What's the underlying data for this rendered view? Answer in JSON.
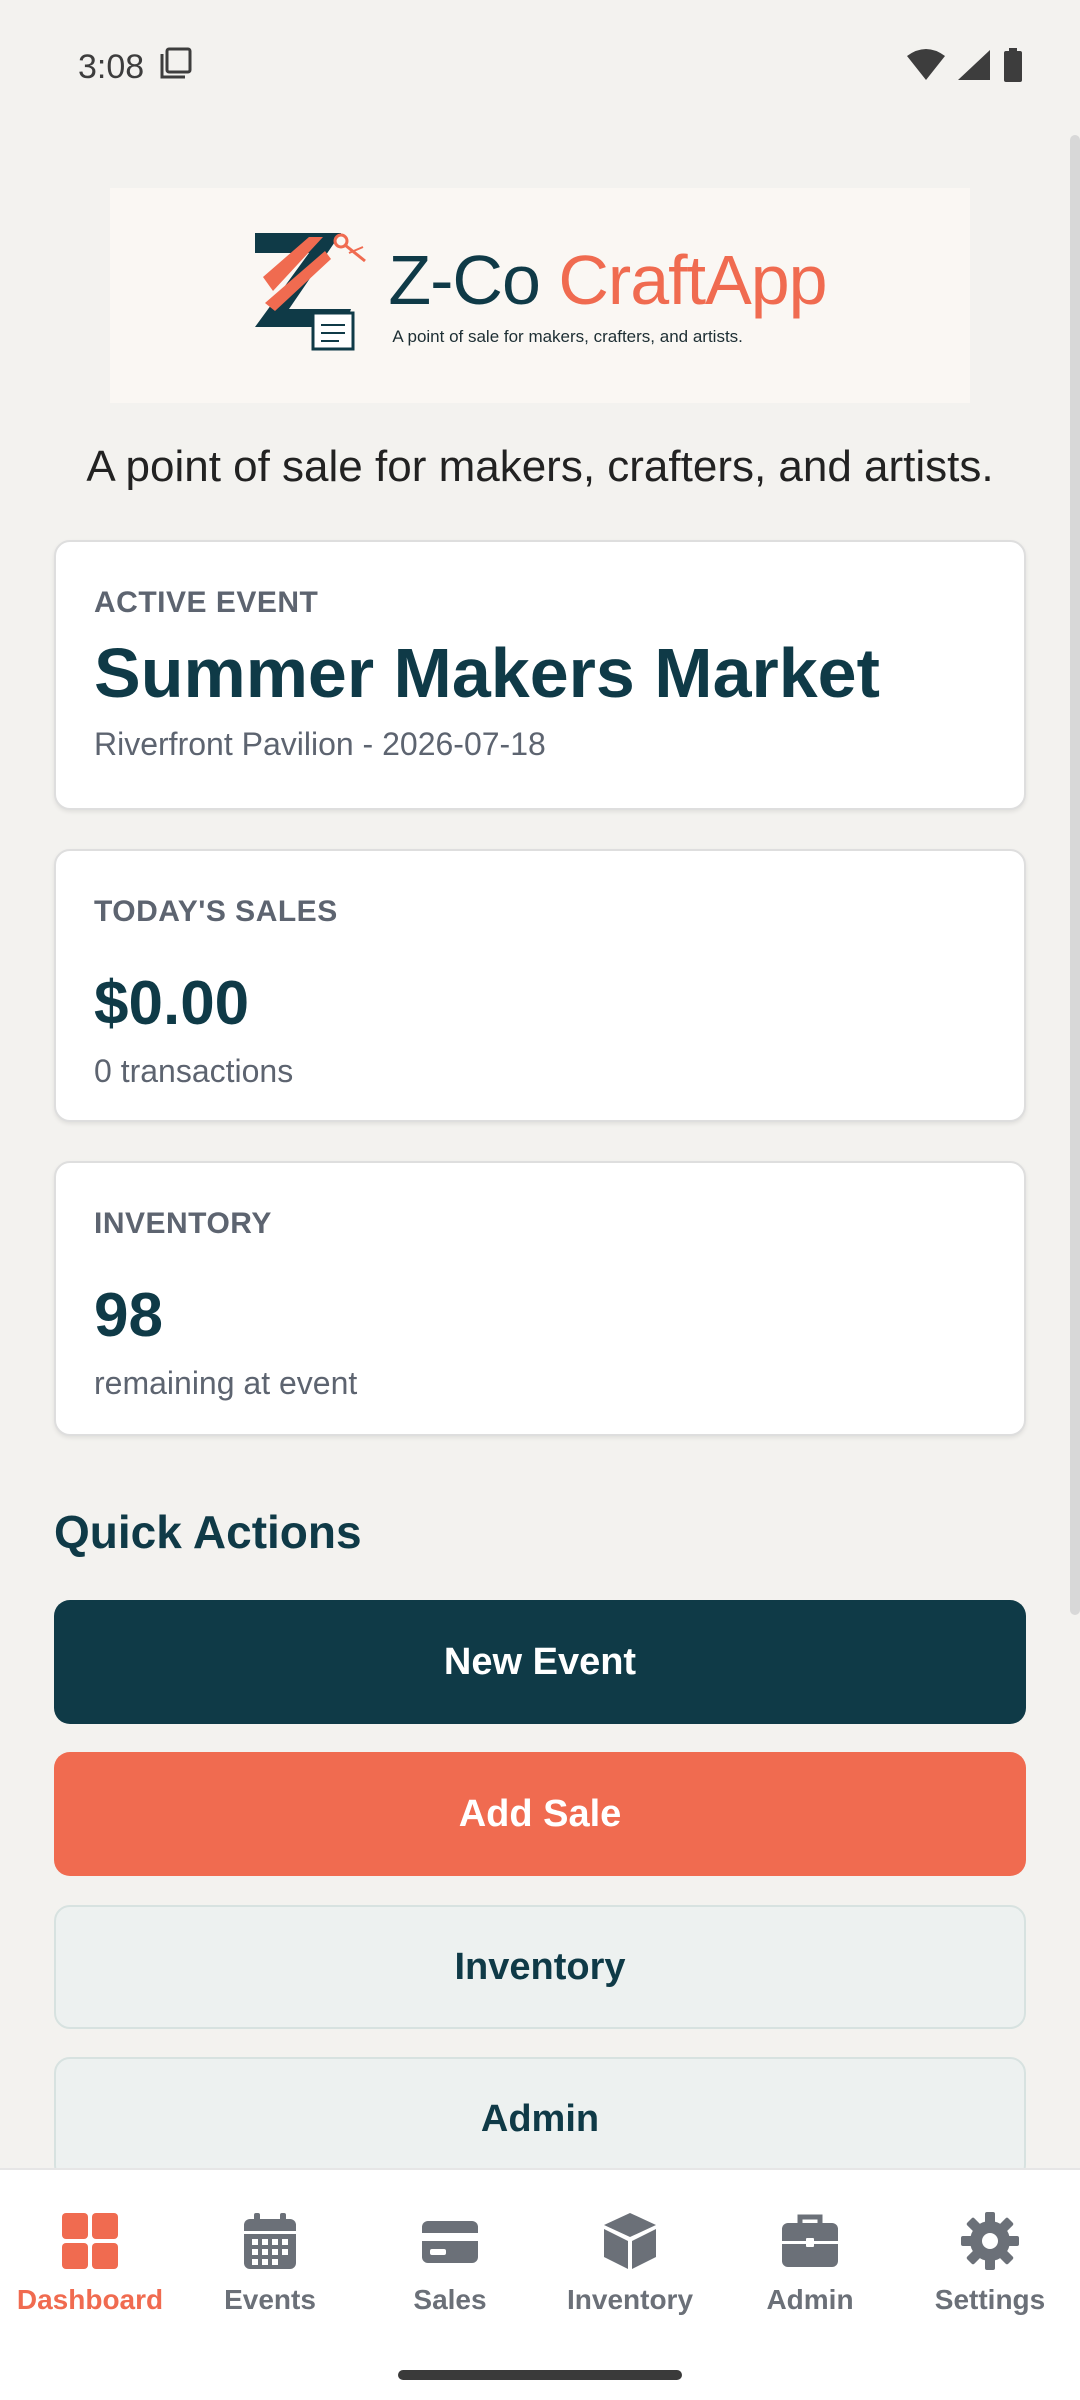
{
  "status_bar": {
    "time": "3:08"
  },
  "logo": {
    "title_part1": "Z-Co",
    "title_part2": "CraftApp",
    "subtitle": "A point of sale for makers, crafters, and artists."
  },
  "tagline": "A point of sale for makers, crafters, and artists.",
  "cards": {
    "active_event": {
      "label": "ACTIVE EVENT",
      "title": "Summer Makers Market",
      "sub": "Riverfront Pavilion - 2026-07-18"
    },
    "todays_sales": {
      "label": "TODAY'S SALES",
      "value": "$0.00",
      "sub": "0 transactions"
    },
    "inventory": {
      "label": "INVENTORY",
      "value": "98",
      "sub": "remaining at event"
    }
  },
  "quick_actions": {
    "title": "Quick Actions",
    "new_event": "New Event",
    "add_sale": "Add Sale",
    "inventory": "Inventory",
    "admin": "Admin"
  },
  "nav": {
    "items": [
      {
        "label": "Dashboard",
        "icon": "dashboard-icon",
        "active": true
      },
      {
        "label": "Events",
        "icon": "calendar-icon",
        "active": false
      },
      {
        "label": "Sales",
        "icon": "credit-card-icon",
        "active": false
      },
      {
        "label": "Inventory",
        "icon": "box-icon",
        "active": false
      },
      {
        "label": "Admin",
        "icon": "briefcase-icon",
        "active": false
      },
      {
        "label": "Settings",
        "icon": "gear-icon",
        "active": false
      }
    ]
  },
  "colors": {
    "primary": "#0f3a47",
    "accent": "#f06b50",
    "background": "#f3f2ef"
  }
}
